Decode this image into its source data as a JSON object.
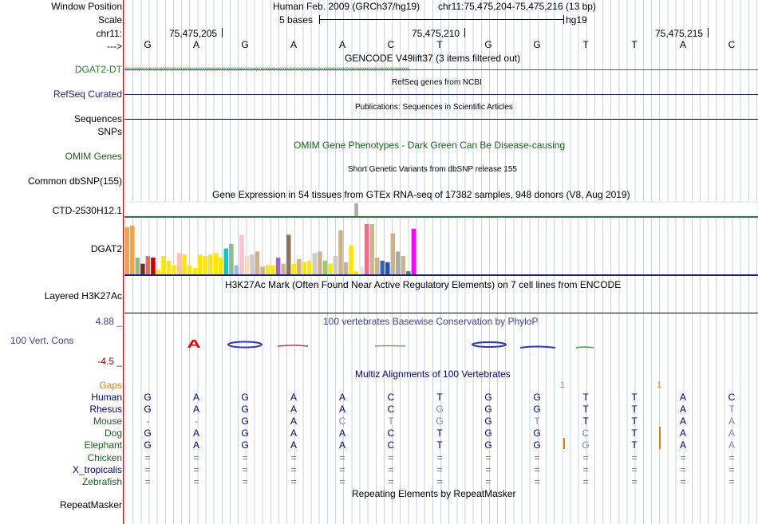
{
  "position": {
    "label": "Window Position",
    "assembly": "Human Feb. 2009 (GRCh37/hg19)",
    "range": "chr11:75,475,204-75,475,216 (13 bp)"
  },
  "scale": {
    "label": "Scale",
    "size": "5 bases",
    "db": "hg19"
  },
  "ruler": {
    "label": "chr11:",
    "ticks": [
      "75,475,205",
      "75,475,210",
      "75,475,215"
    ]
  },
  "sequence": {
    "label": "--->",
    "bases": [
      "G",
      "A",
      "G",
      "A",
      "A",
      "C",
      "T",
      "G",
      "G",
      "T",
      "T",
      "A",
      "C"
    ]
  },
  "tracks": {
    "gencode": {
      "label": "DGAT2-DT",
      "title": "GENCODE V49lift37 (3 items filtered out)",
      "color": "#2e7d32"
    },
    "refseq": {
      "label": "RefSeq Curated",
      "title": "RefSeq genes from NCBI",
      "color": "#1a237e"
    },
    "publications": {
      "title": "Publications: Sequences in Scientific Articles"
    },
    "sequences": {
      "label": "Sequences"
    },
    "snps": {
      "label": "SNPs"
    },
    "omim": {
      "label": "OMIM Genes",
      "title": "OMIM Gene Phenotypes - Dark Green Can Be Disease-causing",
      "color": "#1b5e20"
    },
    "dbsnp": {
      "label": "Common dbSNP(155)",
      "title": "Short Genetic Variants from dbSNP release 155"
    },
    "gtex": {
      "title": "Gene Expression in 54 tissues from GTEx RNA-seq of 17382 samples, 948 donors (V8, Aug 2019)",
      "gene1": "CTD-2530H12.1",
      "gene2": "DGAT2"
    },
    "h3k27ac": {
      "label": "Layered H3K27Ac",
      "title": "H3K27Ac Mark (Often Found Near Active Regulatory Elements) on 7 cell lines from ENCODE"
    },
    "cons": {
      "label": "100 Vert. Cons",
      "max": "4.88 _",
      "min": "-4.5 _",
      "title": "100 vertebrates Basewise Conservation by PhyloP",
      "color": "#3f3f9f"
    },
    "multiz": {
      "title": "Multiz Alignments of 100 Vertebrates",
      "gaps_label": "Gaps",
      "gap_mark": "1"
    },
    "repeat": {
      "label": "RepeatMasker",
      "title": "Repeating Elements by RepeatMasker"
    }
  },
  "alignment": [
    {
      "species": "Human",
      "color": "#000080",
      "bases": [
        "G",
        "A",
        "G",
        "A",
        "A",
        "C",
        "T",
        "G",
        "G",
        "T",
        "T",
        "A",
        "C"
      ]
    },
    {
      "species": "Rhesus",
      "color": "#000080",
      "bases": [
        "G",
        "A",
        "G",
        "A",
        "A",
        "C",
        "G",
        "G",
        "G",
        "T",
        "T",
        "A",
        "T"
      ]
    },
    {
      "species": "Mouse",
      "color": "#1b5e20",
      "bases": [
        "-",
        "-",
        "G",
        "A",
        "C",
        "T",
        "G",
        "G",
        "T",
        "T",
        "T",
        "A",
        "A"
      ]
    },
    {
      "species": "Dog",
      "color": "#1b5e20",
      "bases": [
        "G",
        "A",
        "G",
        "A",
        "A",
        "C",
        "T",
        "G",
        "G",
        "C",
        "T",
        "A",
        "A"
      ]
    },
    {
      "species": "Elephant",
      "color": "#1b5e20",
      "bases": [
        "G",
        "A",
        "G",
        "A",
        "A",
        "C",
        "T",
        "G",
        "G",
        "G",
        "T",
        "A",
        "A"
      ]
    },
    {
      "species": "Chicken",
      "color": "#1b5e20",
      "bases": [
        "=",
        "=",
        "=",
        "=",
        "=",
        "=",
        "=",
        "=",
        "=",
        "=",
        "=",
        "=",
        "="
      ]
    },
    {
      "species": "X_tropicalis",
      "color": "#000080",
      "bases": [
        "=",
        "=",
        "=",
        "=",
        "=",
        "=",
        "=",
        "=",
        "=",
        "=",
        "=",
        "=",
        "="
      ]
    },
    {
      "species": "Zebrafish",
      "color": "#1b5e20",
      "bases": [
        "=",
        "=",
        "=",
        "=",
        "=",
        "=",
        "=",
        "=",
        "=",
        "=",
        "=",
        "=",
        "="
      ]
    }
  ],
  "chart_data": {
    "type": "bar",
    "title": "Gene Expression in 54 tissues from GTEx RNA-seq of 17382 samples, 948 donors (V8, Aug 2019)",
    "series": [
      {
        "name": "CTD-2530H12.1",
        "values": [
          0.2,
          0.2,
          0.1,
          0.1,
          0.1,
          0.1,
          0.1,
          0.1,
          0.1,
          0.1,
          0.1,
          0.1,
          0.1,
          0.1,
          0.1,
          0.1,
          0.1,
          0.1,
          0.1,
          0.1,
          0.1,
          0.1,
          0.1,
          0.1,
          0.1,
          0.1,
          0.1,
          0.1,
          0.1,
          0.1,
          0.1,
          0.1,
          0.1,
          0.1,
          0.1,
          0.1,
          0.1,
          0.1,
          0.1,
          0.1,
          0.1,
          0.1,
          0.1,
          0.1,
          0.1,
          0.1,
          0.1,
          0.1,
          0.1,
          0.1,
          0.1,
          0.1,
          0.1,
          0.1
        ],
        "highlight_index": 44,
        "highlight_value": 0.9
      },
      {
        "name": "DGAT2",
        "values": [
          31,
          32,
          11,
          7,
          12,
          11,
          3,
          12,
          9,
          6,
          14,
          13,
          6,
          4,
          13,
          12,
          13,
          14,
          11,
          17,
          20,
          6,
          26,
          12,
          13,
          15,
          5,
          6,
          6,
          11,
          7,
          26,
          7,
          10,
          8,
          9,
          14,
          15,
          9,
          7,
          12,
          29,
          8,
          19,
          2,
          5,
          33,
          33,
          11,
          9,
          8,
          27,
          15,
          12,
          2,
          30
        ]
      }
    ],
    "colors": [
      "#f7a03c",
      "#f7a03c",
      "#8fbc8f",
      "#6b2d2d",
      "#e07050",
      "#cc0000",
      "#ffe600",
      "#ffe600",
      "#ffe600",
      "#ffe600",
      "#ffbfbf",
      "#ffe600",
      "#ffe600",
      "#ffe600",
      "#ffe600",
      "#ffe600",
      "#ffe600",
      "#ffe600",
      "#ffe600",
      "#00cccc",
      "#8fbc8f",
      "#99bbdd",
      "#ffc0cb",
      "#ffd9b3",
      "#cccccc",
      "#cdb38b",
      "#cdb38b",
      "#ffe600",
      "#ffe600",
      "#9966cc",
      "#cdb38b",
      "#8b7355",
      "#ffe600",
      "#cdb38b",
      "#ffe600",
      "#ffe600",
      "#cccccc",
      "#cdb38b",
      "#99cc66",
      "#ffe600",
      "#cccccc",
      "#cdb38b",
      "#cdb38b",
      "#ffe600",
      "#ffe600",
      "#e6e6e6",
      "#ff6688",
      "#cdb38b",
      "#cdb38b",
      "#3366cc",
      "#1f4fbf",
      "#cdb38b",
      "#aaaaaa",
      "#cdb38b",
      "#2e8b57",
      "#ff00ff"
    ]
  }
}
